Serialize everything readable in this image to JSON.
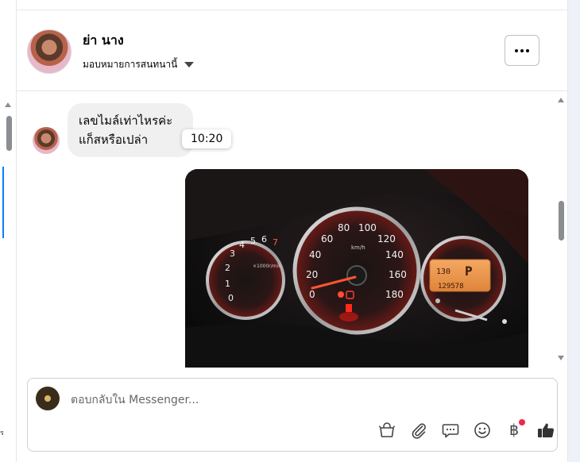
{
  "header": {
    "contact_name": "ย่า นาง",
    "assign_label": "มอบหมายการสนทนานี้"
  },
  "messages": {
    "incoming": {
      "line1": "เลขไมล์เท่าไหรค่ะ",
      "line2": "แก็สหรือเปล่า"
    },
    "timestamp_tooltip": "10:20",
    "photo_gauges": {
      "tach_marks": [
        "0",
        "1",
        "2",
        "3",
        "4",
        "5",
        "6",
        "7"
      ],
      "tach_unit": "×1000r/min",
      "speed_marks": [
        "0",
        "20",
        "40",
        "60",
        "80",
        "100",
        "120",
        "140",
        "160",
        "180"
      ],
      "speed_unit": "km/h",
      "display_top": "130",
      "display_gear": "P",
      "display_odo": "129578"
    }
  },
  "composer": {
    "placeholder": "ตอบกลับใน Messenger...",
    "currency_symbol": "฿"
  },
  "left_strip": {
    "edge_char": "ร"
  },
  "colors": {
    "accent": "#0a7cff",
    "notification": "#f02849",
    "bubble_bg": "#f0f0f0"
  },
  "icons": [
    "shopping-bag-icon",
    "paperclip-icon",
    "saved-reply-icon",
    "emoji-icon",
    "baht-icon",
    "thumbs-up-icon",
    "more-options-icon",
    "chevron-down-icon"
  ]
}
